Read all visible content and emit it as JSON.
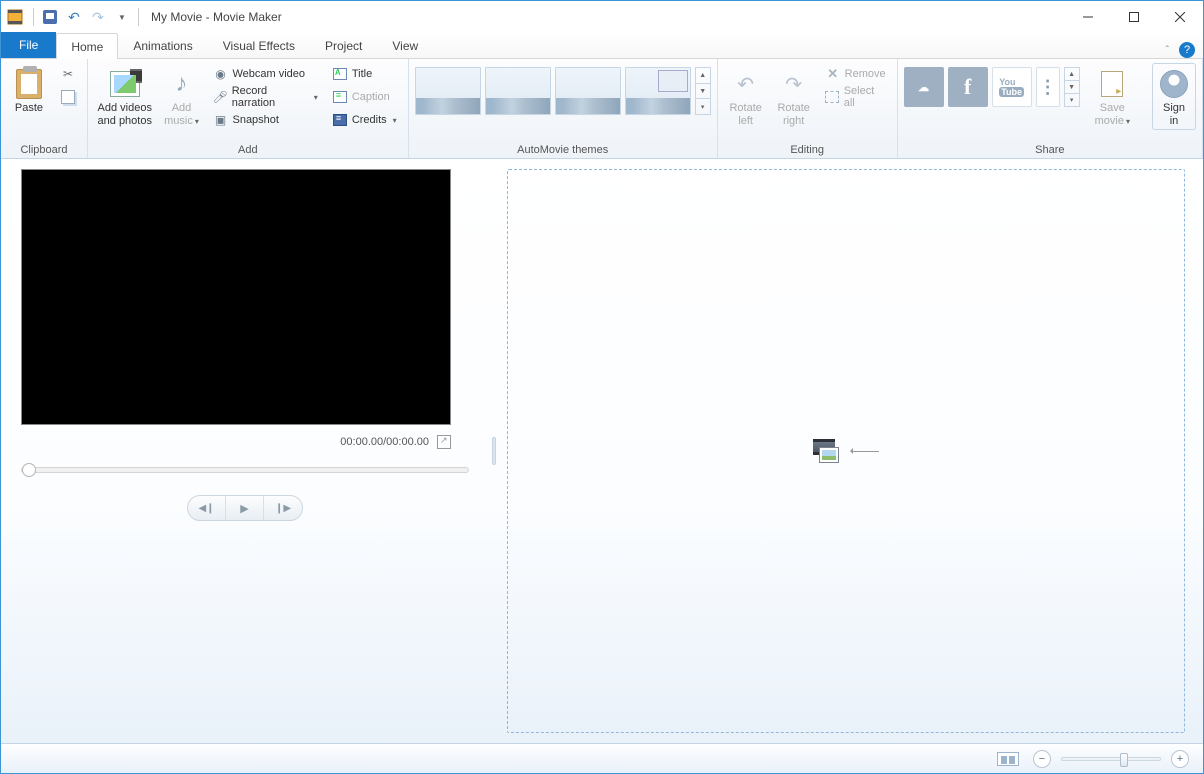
{
  "title": "My Movie - Movie Maker",
  "tabs": {
    "file": "File",
    "home": "Home",
    "animations": "Animations",
    "visual_effects": "Visual Effects",
    "project": "Project",
    "view": "View"
  },
  "ribbon": {
    "clipboard": {
      "label": "Clipboard",
      "paste": "Paste"
    },
    "add": {
      "label": "Add",
      "add_videos": "Add videos\nand photos",
      "add_music": "Add\nmusic",
      "webcam": "Webcam video",
      "record": "Record narration",
      "snapshot": "Snapshot",
      "title": "Title",
      "caption": "Caption",
      "credits": "Credits"
    },
    "themes": {
      "label": "AutoMovie themes"
    },
    "editing": {
      "label": "Editing",
      "rotate_left": "Rotate\nleft",
      "rotate_right": "Rotate\nright",
      "remove": "Remove",
      "select_all": "Select all"
    },
    "share": {
      "label": "Share",
      "save_movie": "Save\nmovie",
      "sign_in": "Sign\nin"
    }
  },
  "preview": {
    "time": "00:00.00/00:00.00"
  }
}
